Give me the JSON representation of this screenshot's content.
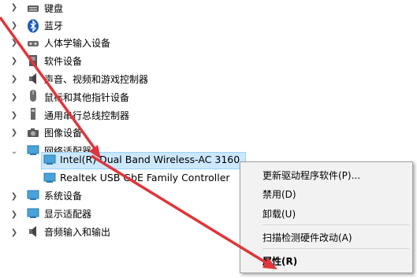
{
  "tree": {
    "items": [
      {
        "label": "键盘",
        "icon": "keyboard-icon"
      },
      {
        "label": "蓝牙",
        "icon": "bluetooth-icon"
      },
      {
        "label": "人体学输入设备",
        "icon": "hid-icon"
      },
      {
        "label": "软件设备",
        "icon": "software-device-icon"
      },
      {
        "label": "声音、视频和游戏控制器",
        "icon": "speaker-icon"
      },
      {
        "label": "鼠标和其他指针设备",
        "icon": "mouse-icon"
      },
      {
        "label": "通用串行总线控制器",
        "icon": "usb-icon"
      },
      {
        "label": "图像设备",
        "icon": "camera-icon"
      },
      {
        "label": "网络适配器",
        "icon": "network-adapter-icon"
      },
      {
        "label": "Intel(R) Dual Band Wireless-AC 3160",
        "icon": "network-adapter-icon"
      },
      {
        "label": "Realtek USB GbE Family Controller",
        "icon": "network-adapter-icon"
      },
      {
        "label": "系统设备",
        "icon": "system-device-icon"
      },
      {
        "label": "显示适配器",
        "icon": "display-adapter-icon"
      },
      {
        "label": "音频输入和输出",
        "icon": "audio-io-icon"
      }
    ]
  },
  "context_menu": {
    "update_driver": "更新驱动程序软件(P)...",
    "disable": "禁用(D)",
    "uninstall": "卸载(U)",
    "scan": "扫描检测硬件改动(A)",
    "properties": "属性(R)"
  },
  "colors": {
    "selection": "#cce8ff",
    "annotation_arrow": "#e0353a"
  }
}
